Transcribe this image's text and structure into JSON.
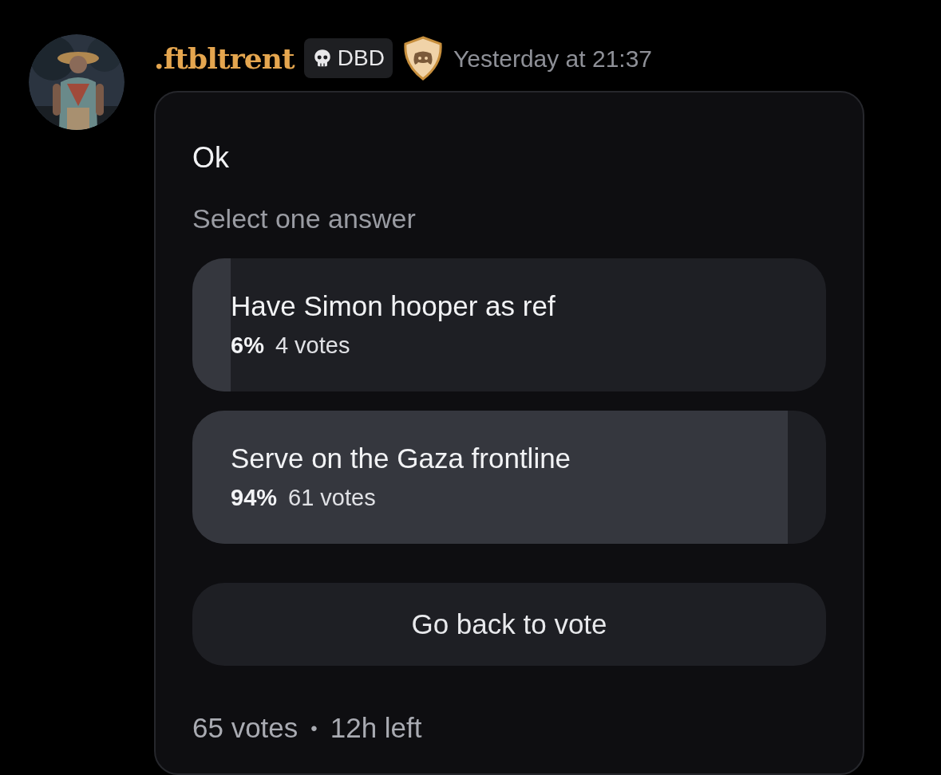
{
  "message": {
    "author": ".ftbltrent",
    "tag": "DBD",
    "timestamp": "Yesterday at 21:37"
  },
  "poll": {
    "question": "Ok",
    "instruction": "Select one answer",
    "answers": [
      {
        "text": "Have Simon hooper as ref",
        "percent": "6%",
        "votes": "4 votes",
        "level": 0.06
      },
      {
        "text": "Serve on the Gaza frontline",
        "percent": "94%",
        "votes": "61 votes",
        "level": 0.94
      }
    ],
    "button": "Go back to vote",
    "total_votes": "65 votes",
    "separator": "•",
    "time_left": "12h left"
  }
}
